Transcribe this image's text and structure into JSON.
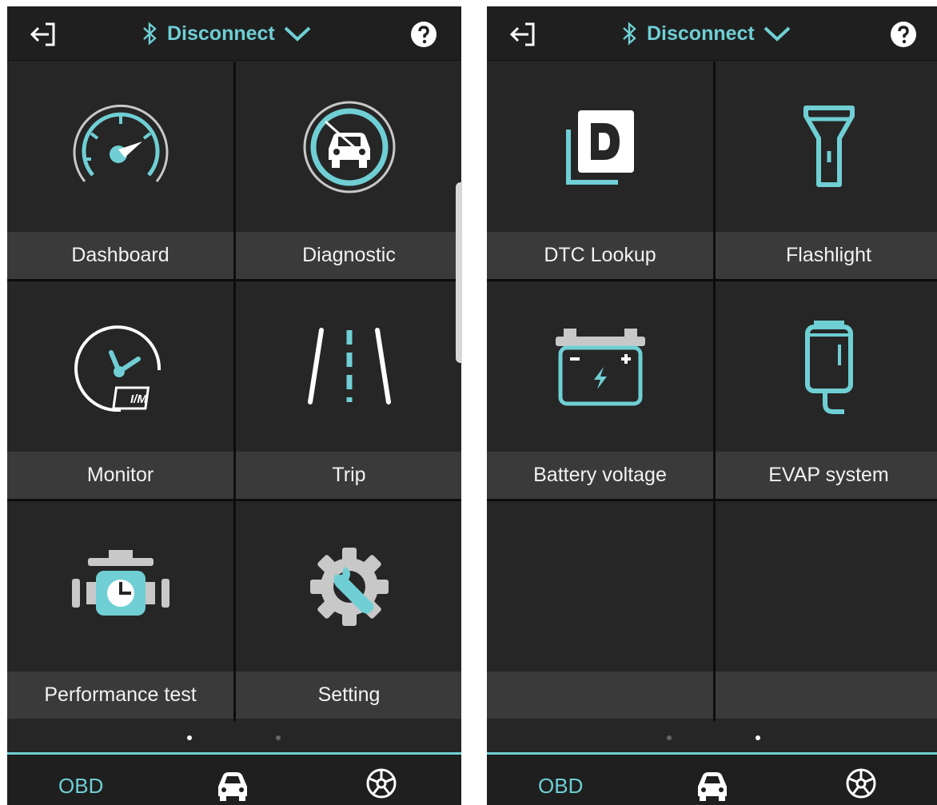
{
  "header": {
    "connection_label": "Disconnect",
    "back_icon": "exit-arrow-icon",
    "bluetooth_icon": "bluetooth-icon",
    "dropdown_icon": "chevron-down-icon",
    "help_icon": "question-mark-icon"
  },
  "left_page": {
    "items": [
      {
        "label": "Dashboard",
        "icon": "speedometer-icon"
      },
      {
        "label": "Diagnostic",
        "icon": "car-diagnostic-icon"
      },
      {
        "label": "Monitor",
        "icon": "im-monitor-gauge-icon"
      },
      {
        "label": "Trip",
        "icon": "road-icon"
      },
      {
        "label": "Performance test",
        "icon": "engine-timer-icon"
      },
      {
        "label": "Setting",
        "icon": "gear-wrench-icon"
      }
    ],
    "active_page_dot": 1,
    "page_count": 2
  },
  "right_page": {
    "items": [
      {
        "label": "DTC Lookup",
        "icon": "dtc-document-icon"
      },
      {
        "label": "Flashlight",
        "icon": "flashlight-icon"
      },
      {
        "label": "Battery voltage",
        "icon": "battery-icon"
      },
      {
        "label": "EVAP system",
        "icon": "evap-canister-icon"
      },
      {
        "label": "",
        "icon": ""
      },
      {
        "label": "",
        "icon": ""
      }
    ],
    "active_page_dot": 2,
    "page_count": 2
  },
  "bottom_nav": {
    "tabs": [
      {
        "label": "OBD",
        "active": true
      },
      {
        "label": "",
        "icon": "car-icon",
        "active": false
      },
      {
        "label": "",
        "icon": "steering-wheel-icon",
        "active": false
      }
    ]
  },
  "colors": {
    "accent": "#6fcfd4",
    "background": "#262626",
    "label_bar": "#3a3a3a",
    "icon_light": "#ffffff",
    "icon_grey": "#c8c8c8"
  }
}
